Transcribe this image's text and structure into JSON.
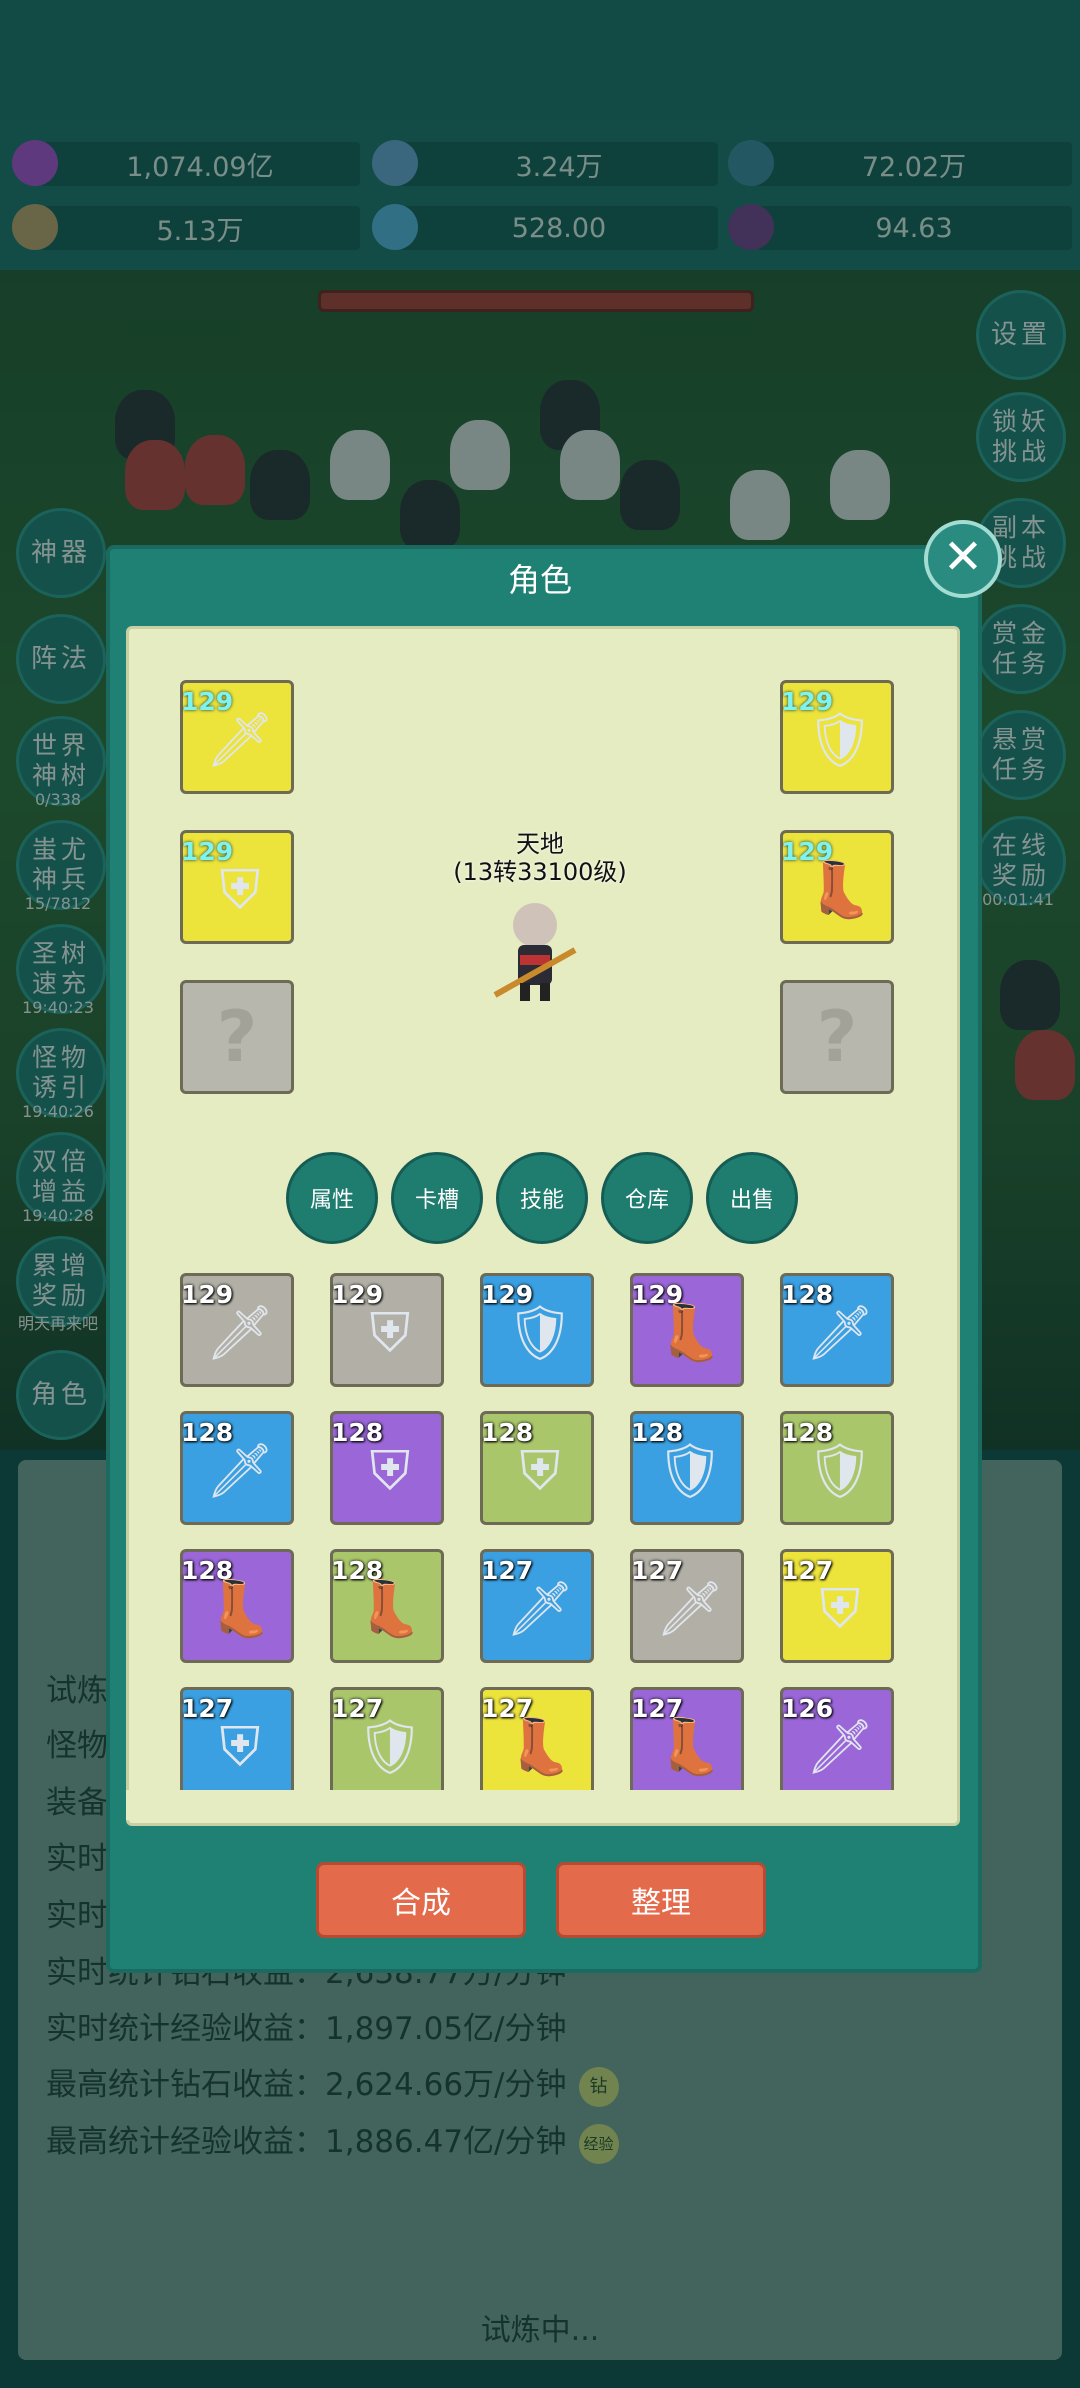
{
  "resources": [
    {
      "value": "1,074.09亿",
      "icon": "purple-gem-icon",
      "color": "#b24bd6"
    },
    {
      "value": "3.24万",
      "icon": "blue-orb-icon",
      "color": "#6aa6d8"
    },
    {
      "value": "72.02万",
      "icon": "earth-globe-icon",
      "color": "#3c88a0"
    },
    {
      "value": "5.13万",
      "icon": "scroll-icon",
      "color": "#c9a26b"
    },
    {
      "value": "528.00",
      "icon": "blue-crystal-icon",
      "color": "#58b6e6"
    },
    {
      "value": "94.63",
      "icon": "purple-potion-icon",
      "color": "#7a3a8c"
    }
  ],
  "left_menu": [
    {
      "label": "神器",
      "sub": ""
    },
    {
      "label": "阵法",
      "sub": ""
    },
    {
      "label": "世界神树",
      "sub": "0/338"
    },
    {
      "label": "蚩尤神兵",
      "sub": "15/7812"
    },
    {
      "label": "圣树速充",
      "sub": "19:40:23"
    },
    {
      "label": "怪物诱引",
      "sub": "19:40:26"
    },
    {
      "label": "双倍增益",
      "sub": "19:40:28"
    },
    {
      "label": "累增奖励",
      "sub": "明天再来吧"
    },
    {
      "label": "角色",
      "sub": ""
    }
  ],
  "right_menu": [
    {
      "label": "设置",
      "sub": ""
    },
    {
      "label": "锁妖挑战",
      "sub": ""
    },
    {
      "label": "副本挑战",
      "sub": ""
    },
    {
      "label": "赏金任务",
      "sub": ""
    },
    {
      "label": "悬赏任务",
      "sub": ""
    },
    {
      "label": "在线奖励",
      "sub": "00:01:41"
    }
  ],
  "stats": {
    "row1": "试炼",
    "row2": "怪物",
    "row3": "装备",
    "row4": "实时",
    "row5": "实时",
    "row6": "实时统计钻石收益：2,638.77万/分钟",
    "row7": "实时统计经验收益：1,897.05亿/分钟",
    "row8": "最高统计钻石收益：2,624.66万/分钟",
    "row8_badge": "钻",
    "row9": "最高统计经验收益：1,886.47亿/分钟",
    "row9_badge": "经验",
    "status": "试炼中..."
  },
  "dialog": {
    "title": "角色",
    "hero_name": "天地",
    "hero_level": "(13转33100级)",
    "equipped": [
      {
        "slot": "weapon",
        "level": "129",
        "color": "yellow",
        "icon": "sword-icon"
      },
      {
        "slot": "armor",
        "level": "129",
        "color": "yellow",
        "icon": "armor-icon"
      },
      {
        "slot": "empty-left",
        "level": "",
        "color": "empty",
        "icon": "question-icon"
      },
      {
        "slot": "shield",
        "level": "129",
        "color": "yellow",
        "icon": "shield-icon"
      },
      {
        "slot": "boots",
        "level": "129",
        "color": "yellow",
        "icon": "boots-icon"
      },
      {
        "slot": "empty-right",
        "level": "",
        "color": "empty",
        "icon": "question-icon"
      }
    ],
    "tabs": [
      "属性",
      "卡槽",
      "技能",
      "仓库",
      "出售"
    ],
    "inventory": [
      {
        "level": "129",
        "color": "grey",
        "icon": "sword-icon"
      },
      {
        "level": "129",
        "color": "grey",
        "icon": "armor-icon"
      },
      {
        "level": "129",
        "color": "blue",
        "icon": "shield-icon"
      },
      {
        "level": "129",
        "color": "purple",
        "icon": "boots-icon"
      },
      {
        "level": "128",
        "color": "blue",
        "icon": "sword-icon"
      },
      {
        "level": "128",
        "color": "blue",
        "icon": "sword-icon"
      },
      {
        "level": "128",
        "color": "purple",
        "icon": "armor-icon"
      },
      {
        "level": "128",
        "color": "green",
        "icon": "armor-icon"
      },
      {
        "level": "128",
        "color": "blue",
        "icon": "shield-icon"
      },
      {
        "level": "128",
        "color": "green",
        "icon": "shield-icon"
      },
      {
        "level": "128",
        "color": "purple",
        "icon": "boots-icon"
      },
      {
        "level": "128",
        "color": "green",
        "icon": "boots-icon"
      },
      {
        "level": "127",
        "color": "blue",
        "icon": "sword-icon"
      },
      {
        "level": "127",
        "color": "grey",
        "icon": "sword-icon"
      },
      {
        "level": "127",
        "color": "yellow",
        "icon": "armor-icon"
      },
      {
        "level": "127",
        "color": "blue",
        "icon": "armor-icon"
      },
      {
        "level": "127",
        "color": "green",
        "icon": "shield-icon"
      },
      {
        "level": "127",
        "color": "yellow",
        "icon": "boots-icon"
      },
      {
        "level": "127",
        "color": "purple",
        "icon": "boots-icon"
      },
      {
        "level": "126",
        "color": "purple",
        "icon": "sword-icon"
      }
    ],
    "synthesize_label": "合成",
    "organize_label": "整理"
  }
}
